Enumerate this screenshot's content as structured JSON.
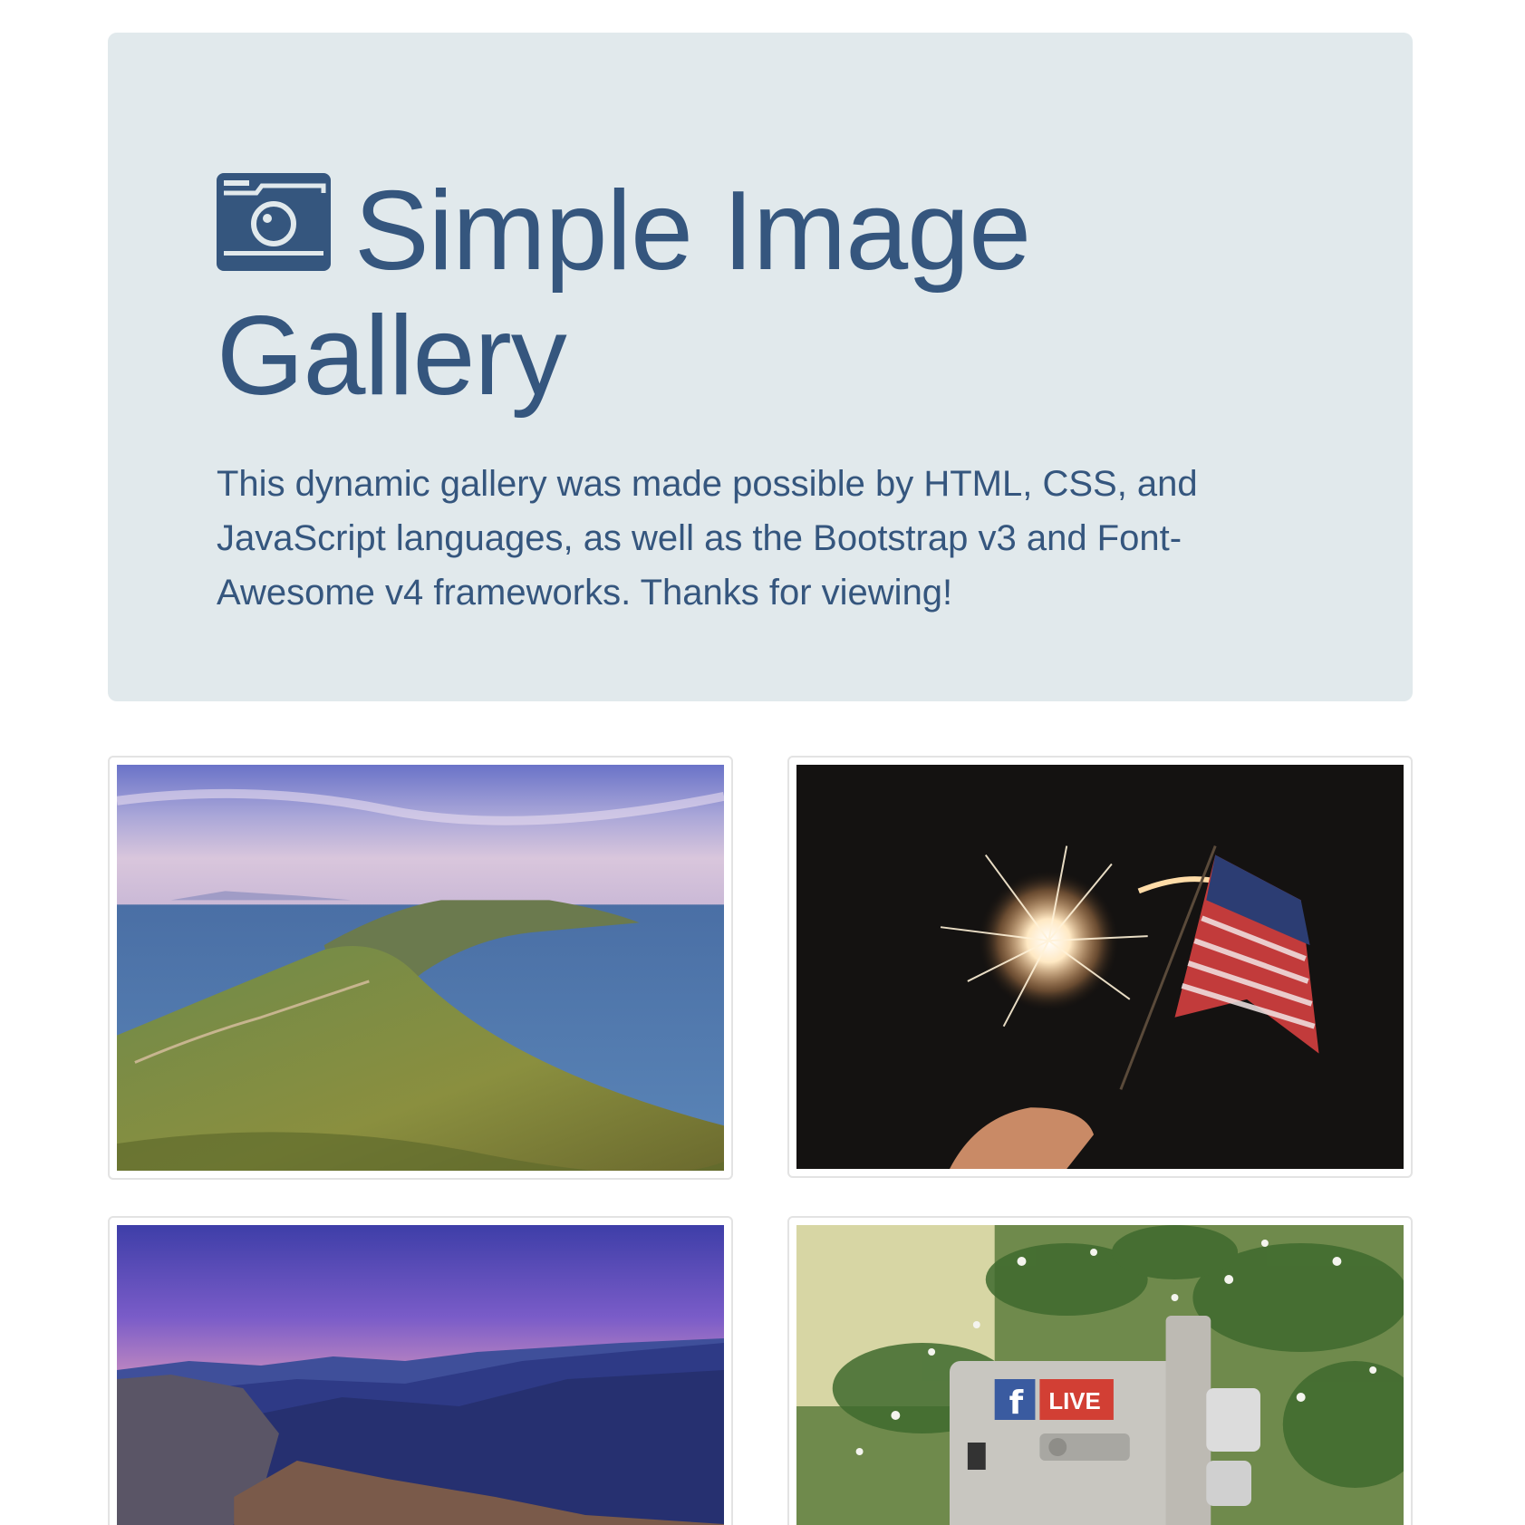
{
  "header": {
    "title": "Simple Image Gallery",
    "description": "This dynamic gallery was made possible by HTML, CSS, and JavaScript languages, as well as the Bootstrap v3 and Font-Awesome v4 frameworks. Thanks for viewing!",
    "icon": "camera-retro-icon"
  },
  "colors": {
    "jumbotron_bg": "#e1e9ec",
    "title": "#35567e",
    "thumb_border": "#e3e3e3"
  },
  "gallery": {
    "items": [
      {
        "alt": "coastal-peninsula-photo"
      },
      {
        "alt": "sparkler-american-flag-photo"
      },
      {
        "alt": "mountain-sunset-photo"
      },
      {
        "alt": "facebook-live-camera-photo",
        "sticker_text": "LIVE"
      }
    ]
  }
}
